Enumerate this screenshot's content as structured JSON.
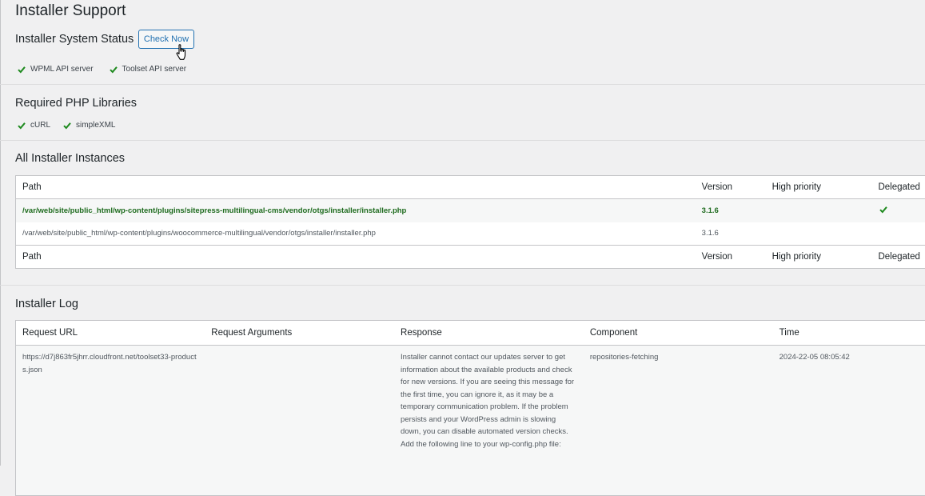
{
  "page": {
    "title": "Installer Support"
  },
  "system_status": {
    "title": "Installer System Status",
    "check_now_label": "Check Now",
    "items": [
      {
        "label": "WPML API server",
        "icon": "check-icon"
      },
      {
        "label": "Toolset API server",
        "icon": "check-icon"
      }
    ]
  },
  "php_libraries": {
    "title": "Required PHP Libraries",
    "items": [
      {
        "label": "cURL",
        "icon": "check-icon"
      },
      {
        "label": "simpleXML",
        "icon": "check-icon"
      }
    ]
  },
  "instances": {
    "title": "All Installer Instances",
    "columns": [
      "Path",
      "Version",
      "High priority",
      "Delegated"
    ],
    "rows": [
      {
        "path": "/var/web/site/public_html/wp-content/plugins/sitepress-multilingual-cms/vendor/otgs/installer/installer.php",
        "version": "3.1.6",
        "high_priority": "",
        "delegated": true,
        "active": true
      },
      {
        "path": "/var/web/site/public_html/wp-content/plugins/woocommerce-multilingual/vendor/otgs/installer/installer.php",
        "version": "3.1.6",
        "high_priority": "",
        "delegated": false,
        "active": false
      }
    ]
  },
  "log": {
    "title": "Installer Log",
    "columns": [
      "Request URL",
      "Request Arguments",
      "Response",
      "Component",
      "Time"
    ],
    "rows": [
      {
        "request_url": "https://d7j863fr5jhrr.cloudfront.net/toolset33-products.json",
        "request_arguments": "",
        "response": "Installer cannot contact our updates server to get information about the available products and check for new versions. If you are seeing this message for the first time, you can ignore it, as it may be a temporary communication problem. If the problem persists and your WordPress admin is slowing down, you can disable automated version checks. Add the following line to your wp-config.php file:",
        "component": "repositories-fetching",
        "time": "2024-22-05 08:05:42"
      }
    ]
  },
  "colors": {
    "accent": "#2271b1",
    "check_green": "#1e8a1e",
    "active_row_text": "#1e6b1e",
    "background": "#f0f0f1"
  }
}
